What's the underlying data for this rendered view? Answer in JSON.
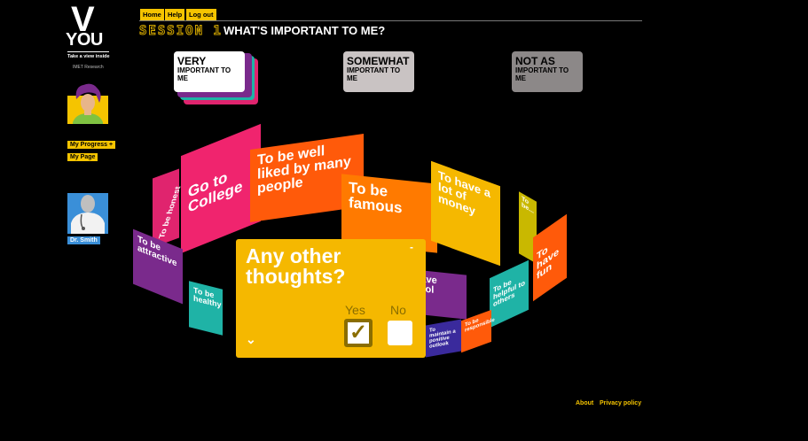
{
  "logo": {
    "v": "V",
    "you": "YOU",
    "tagline": "Take a view inside",
    "org": "IMET Research"
  },
  "sidebar": {
    "my_progress": "My Progress",
    "plus": "+",
    "my_page": "My Page",
    "doctor": "Dr. Smith"
  },
  "nav": {
    "home": "Home",
    "help": "Help",
    "logout": "Log out"
  },
  "header": {
    "session": "SESSION 1",
    "title": "WHAT'S IMPORTANT TO ME?"
  },
  "categories": {
    "very": {
      "big": "VERY",
      "small": "IMPORTANT TO ME"
    },
    "somewhat": {
      "big": "SOMEWHAT",
      "small": "IMPORTANT TO ME"
    },
    "not_as": {
      "big": "NOT AS",
      "small": "IMPORTANT TO ME"
    }
  },
  "cards": {
    "honest": "To be honest",
    "college": "Go to College",
    "liked": "To be well liked by many people",
    "famous": "To be famous",
    "money": "To have a lot of money",
    "small_right": "To be...",
    "fun": "To have fun",
    "attractive": "To be attractive",
    "healthy": "To be healthy",
    "control": "To have control",
    "helpful": "To be helpful to others",
    "positive": "To maintain a positive outlook",
    "responsible": "To be responsible"
  },
  "dialog": {
    "question": "Any other thoughts?",
    "minimize": "-",
    "yes": "Yes",
    "no": "No",
    "check": "✓",
    "chevron": "⌄"
  },
  "footer": {
    "about": "About",
    "privacy": "Privacy policy"
  },
  "colors": {
    "accent": "#f5c400",
    "pink": "#f0246e",
    "orange": "#ff5a0a",
    "purple": "#7a2a8c",
    "teal": "#1fb3a6"
  }
}
